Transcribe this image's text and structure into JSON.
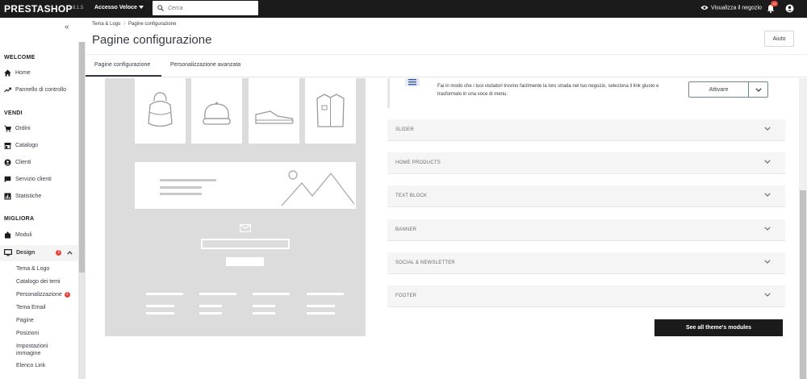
{
  "topbar": {
    "logo": "PRESTASHOP",
    "version": "8.1.5",
    "quick_access": "Accesso Veloce",
    "search_placeholder": "Cerca",
    "view_shop": "Visualizza il negozio",
    "notifications_count": "45"
  },
  "sidebar": {
    "sections": {
      "welcome": "WELCOME",
      "vendi": "VENDI",
      "migliora": "MIGLIORA"
    },
    "welcome_items": [
      "Home",
      "Pannello di controllo"
    ],
    "vendi_items": [
      "Ordini",
      "Catalogo",
      "Clienti",
      "Servizio clienti",
      "Statistiche"
    ],
    "migliora_items": [
      "Moduli",
      "Design"
    ],
    "design_badge": "1",
    "design_sub": [
      "Tema & Logo",
      "Catalogo dei temi",
      "Personalizzazione",
      "Tema Email",
      "Pagine",
      "Posizioni",
      "Impostazioni immagine",
      "Elenco Link"
    ],
    "personalizzazione_badge": "1"
  },
  "header": {
    "breadcrumb": [
      "Tema & Logo",
      "Pagine configurazione"
    ],
    "title": "Pagine configurazione",
    "help": "Aiuto",
    "tabs": [
      "Pagine configurazione",
      "Personalizzazione avanzata"
    ]
  },
  "module": {
    "description": "Fai in modo che i tuoi visitatori trovino facilmente la loro strada nel tuo negozio, seleziona il link giusto e trasformalo in una voce di menu.",
    "activate": "Attivare"
  },
  "accordion": [
    "SLIDER",
    "HOME PRODUCTS",
    "TEXT BLOCK",
    "BANNER",
    "SOCIAL & NEWSLETTER",
    "FOOTER"
  ],
  "all_modules_button": "See all theme's modules",
  "colors": {
    "topbar": "#1b1b1b",
    "badge": "#e5433b",
    "accordion_bg": "#f5f5f5",
    "preview_bg": "#dcdcdc"
  }
}
